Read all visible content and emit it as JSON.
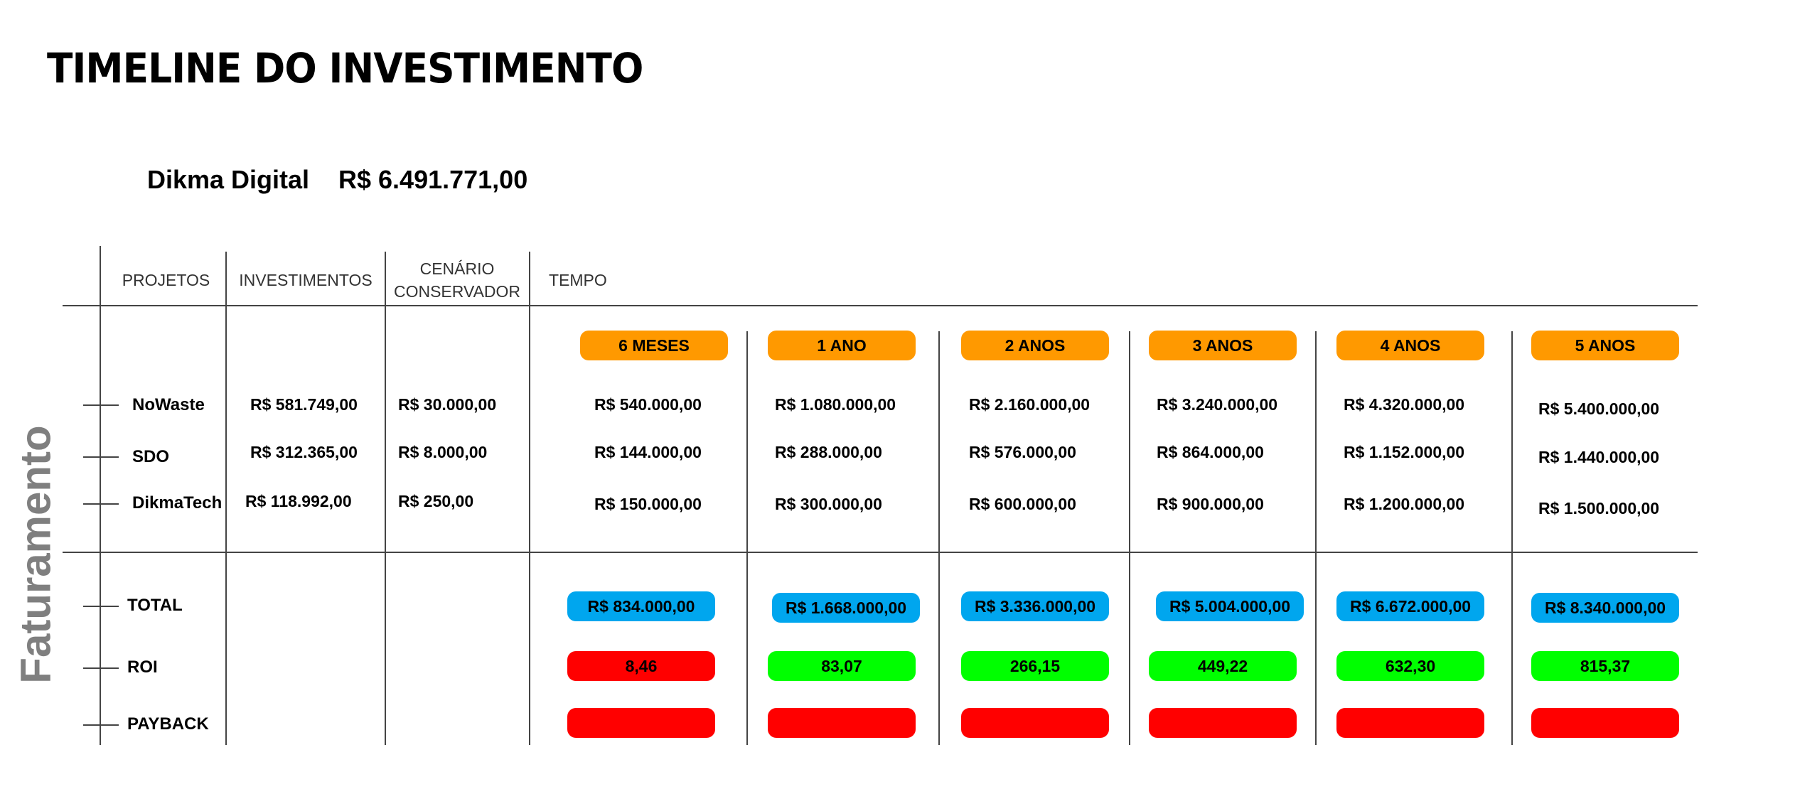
{
  "title": "TIMELINE DO INVESTIMENTO",
  "company": {
    "name": "Dikma Digital",
    "total": "R$ 6.491.771,00"
  },
  "side_label": "Faturamento",
  "headers": {
    "projetos": "PROJETOS",
    "investimentos": "INVESTIMENTOS",
    "cenario_line1": "CENÁRIO",
    "cenario_line2": "CONSERVADOR",
    "tempo": "TEMPO"
  },
  "periods": [
    "6 MESES",
    "1 ANO",
    "2 ANOS",
    "3 ANOS",
    "4 ANOS",
    "5 ANOS"
  ],
  "projects": [
    {
      "name": "NoWaste",
      "investimento": "R$ 581.749,00",
      "cenario": "R$ 30.000,00",
      "values": [
        "R$ 540.000,00",
        "R$ 1.080.000,00",
        "R$ 2.160.000,00",
        "R$ 3.240.000,00",
        "R$ 4.320.000,00",
        "R$ 5.400.000,00"
      ]
    },
    {
      "name": "SDO",
      "investimento": "R$ 312.365,00",
      "cenario": "R$ 8.000,00",
      "values": [
        "R$ 144.000,00",
        "R$ 288.000,00",
        "R$ 576.000,00",
        "R$ 864.000,00",
        "R$ 1.152.000,00",
        "R$ 1.440.000,00"
      ]
    },
    {
      "name": "DikmaTech",
      "investimento": "R$ 118.992,00",
      "cenario": "R$ 250,00",
      "values": [
        "R$ 150.000,00",
        "R$ 300.000,00",
        "R$ 600.000,00",
        "R$ 900.000,00",
        "R$ 1.200.000,00",
        "R$ 1.500.000,00"
      ]
    }
  ],
  "summary": {
    "total_label": "TOTAL",
    "roi_label": "ROI",
    "payback_label": "PAYBACK",
    "total": [
      "R$ 834.000,00",
      "R$ 1.668.000,00",
      "R$ 3.336.000,00",
      "R$ 5.004.000,00",
      "R$ 6.672.000,00",
      "R$ 8.340.000,00"
    ],
    "roi": [
      "8,46",
      "83,07",
      "266,15",
      "449,22",
      "632,30",
      "815,37"
    ],
    "roi_status": [
      "negative",
      "positive",
      "positive",
      "positive",
      "positive",
      "positive"
    ],
    "payback": [
      "",
      "",
      "",
      "",
      "",
      ""
    ]
  },
  "colors": {
    "period_badge": "#ff9900",
    "total_badge": "#00a6ee",
    "roi_negative": "#ff0000",
    "roi_positive": "#00ff00",
    "payback_badge": "#ff0000",
    "side_label": "#7f7f7f"
  }
}
